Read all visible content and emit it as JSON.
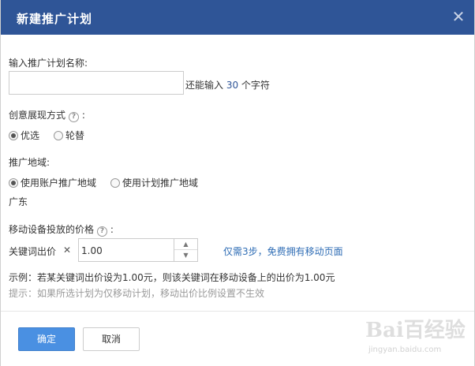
{
  "dialog": {
    "title": "新建推广计划",
    "close_icon": "close-icon",
    "close_glyph": "✕"
  },
  "plan_name": {
    "label": "输入推广计划名称:",
    "value": "",
    "placeholder": "",
    "hint_prefix": "还能输入 ",
    "hint_count": "30",
    "hint_suffix": " 个字符"
  },
  "creative_display": {
    "label": "创意展现方式",
    "help_icon": "question-circle-icon",
    "colon": ":",
    "options": [
      {
        "label": "优选",
        "checked": true
      },
      {
        "label": "轮替",
        "checked": false
      }
    ]
  },
  "region": {
    "label": "推广地域:",
    "options": [
      {
        "label": "使用账户推广地域",
        "checked": true
      },
      {
        "label": "使用计划推广地域",
        "checked": false
      }
    ],
    "current": "广东"
  },
  "mobile_price": {
    "label": "移动设备投放的价格",
    "help_icon": "question-circle-icon",
    "colon": ":",
    "keyword_price_label": "关键词出价",
    "multiply_glyph": "✕",
    "ratio_value": "1.00",
    "link_text": "仅需3步，免费拥有移动页面"
  },
  "example_text": "示例：若某关键词出价设为1.00元，则该关键词在移动设备上的出价为1.00元",
  "tip_text": "提示：如果所选计划为仅移动计划，移动出价比例设置不生效",
  "buttons": {
    "ok_label": "确定",
    "cancel_label": "取消"
  },
  "watermark": {
    "main": "Bai百经验",
    "sub": "jingyan.baidu.com"
  },
  "colors": {
    "titlebar": "#2f5597",
    "primary_button": "#4a90e2",
    "link": "#2f6db5"
  }
}
